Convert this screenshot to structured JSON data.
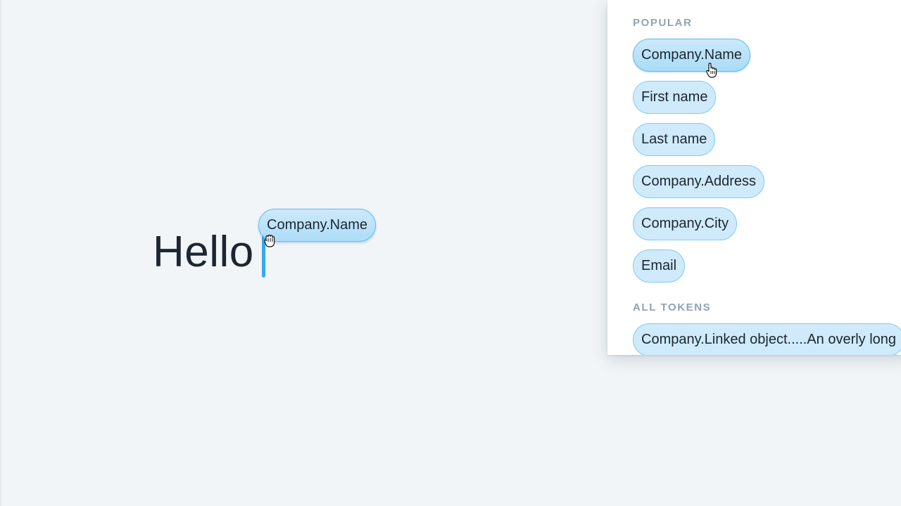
{
  "editor": {
    "text": "Hello",
    "dragged_token": "Company.Name"
  },
  "panel": {
    "popular_label": "POPULAR",
    "popular_tokens": [
      "Company.Name",
      "First name",
      "Last name",
      "Company.Address",
      "Company.City",
      "Email"
    ],
    "all_tokens_label": "ALL TOKENS",
    "all_tokens": [
      "Company.Linked object.....An overly long"
    ]
  },
  "colors": {
    "background": "#f1f5f7",
    "token_fill": "#cfeafb",
    "token_border": "#7ecbf3",
    "caret": "#33aaf0",
    "section_label": "#8ea4b2",
    "text": "#1d2530"
  },
  "icons": {
    "drag_cursor": "grab-hand-icon",
    "hover_cursor": "pointer-hand-icon"
  }
}
